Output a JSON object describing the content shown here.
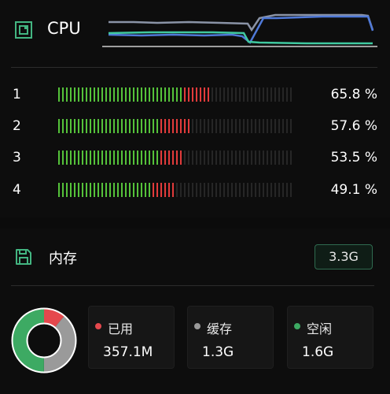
{
  "cpu": {
    "title": "CPU",
    "icon": "cpu-chip-icon",
    "cores": [
      {
        "label": "1",
        "value": "65.8 %",
        "green_fraction": 0.54,
        "red_fraction": 0.12
      },
      {
        "label": "2",
        "value": "57.6 %",
        "green_fraction": 0.44,
        "red_fraction": 0.14
      },
      {
        "label": "3",
        "value": "53.5 %",
        "green_fraction": 0.44,
        "red_fraction": 0.1
      },
      {
        "label": "4",
        "value": "49.1 %",
        "green_fraction": 0.4,
        "red_fraction": 0.1
      }
    ],
    "colors": {
      "used": "#55c23a",
      "high": "#e23b3b",
      "empty": "#262626"
    }
  },
  "memory": {
    "title": "内存",
    "icon": "save-disk-icon",
    "total": "3.3G",
    "stats": [
      {
        "label": "已用",
        "value": "357.1M",
        "color": "#e5484d"
      },
      {
        "label": "缓存",
        "value": "1.3G",
        "color": "#9a9a9a"
      },
      {
        "label": "空闲",
        "value": "1.6G",
        "color": "#3daa63"
      }
    ],
    "donut": {
      "used": 0.11,
      "cache": 0.39,
      "free": 0.5
    }
  }
}
